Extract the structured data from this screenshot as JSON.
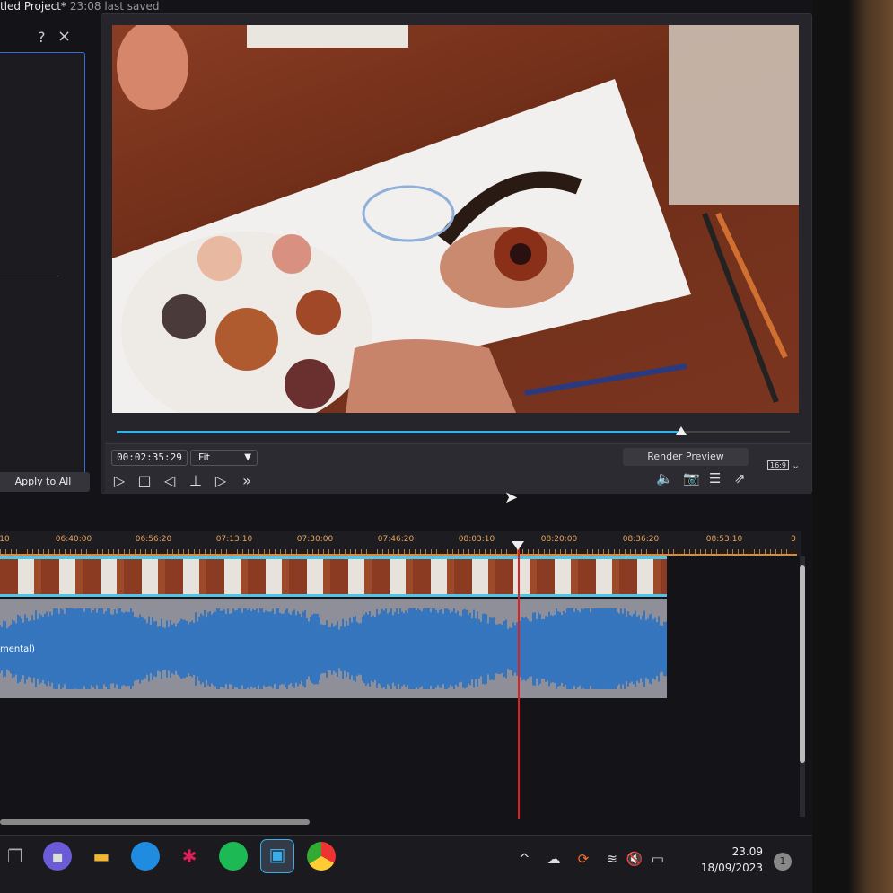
{
  "window": {
    "title": "tled Project*",
    "saved": "23:08 last saved"
  },
  "left_panel": {
    "help": "?",
    "close": "×",
    "apply_label": "Apply to All"
  },
  "preview": {
    "progress_fraction": 0.837,
    "timecode": "00:02:35:29",
    "zoom": "Fit",
    "render_label": "Render Preview",
    "aspect": "16:9"
  },
  "timeline": {
    "ruler_labels": [
      "10",
      "06:40:00",
      "06:56:20",
      "07:13:10",
      "07:30:00",
      "07:46:20",
      "08:03:10",
      "08:20:00",
      "08:36:20",
      "08:53:10",
      "0"
    ],
    "audio_clip_label": "mental)",
    "accent": "#4fc6e8",
    "playhead_color": "#e02020"
  },
  "taskbar": {
    "time": "23.09",
    "date": "18/09/2023",
    "notifications": "1"
  }
}
